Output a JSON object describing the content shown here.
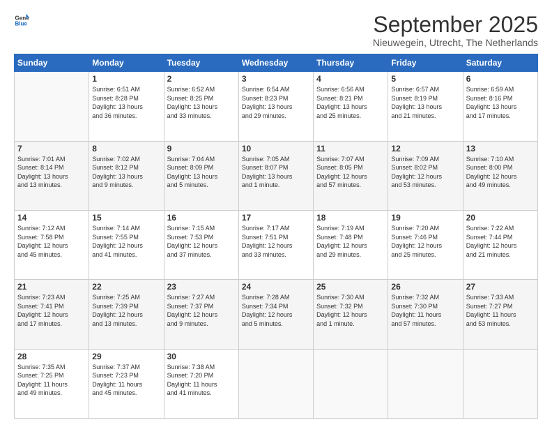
{
  "header": {
    "logo_general": "General",
    "logo_blue": "Blue",
    "month_title": "September 2025",
    "subtitle": "Nieuwegein, Utrecht, The Netherlands"
  },
  "weekdays": [
    "Sunday",
    "Monday",
    "Tuesday",
    "Wednesday",
    "Thursday",
    "Friday",
    "Saturday"
  ],
  "weeks": [
    [
      {
        "day": "",
        "info": ""
      },
      {
        "day": "1",
        "info": "Sunrise: 6:51 AM\nSunset: 8:28 PM\nDaylight: 13 hours\nand 36 minutes."
      },
      {
        "day": "2",
        "info": "Sunrise: 6:52 AM\nSunset: 8:25 PM\nDaylight: 13 hours\nand 33 minutes."
      },
      {
        "day": "3",
        "info": "Sunrise: 6:54 AM\nSunset: 8:23 PM\nDaylight: 13 hours\nand 29 minutes."
      },
      {
        "day": "4",
        "info": "Sunrise: 6:56 AM\nSunset: 8:21 PM\nDaylight: 13 hours\nand 25 minutes."
      },
      {
        "day": "5",
        "info": "Sunrise: 6:57 AM\nSunset: 8:19 PM\nDaylight: 13 hours\nand 21 minutes."
      },
      {
        "day": "6",
        "info": "Sunrise: 6:59 AM\nSunset: 8:16 PM\nDaylight: 13 hours\nand 17 minutes."
      }
    ],
    [
      {
        "day": "7",
        "info": "Sunrise: 7:01 AM\nSunset: 8:14 PM\nDaylight: 13 hours\nand 13 minutes."
      },
      {
        "day": "8",
        "info": "Sunrise: 7:02 AM\nSunset: 8:12 PM\nDaylight: 13 hours\nand 9 minutes."
      },
      {
        "day": "9",
        "info": "Sunrise: 7:04 AM\nSunset: 8:09 PM\nDaylight: 13 hours\nand 5 minutes."
      },
      {
        "day": "10",
        "info": "Sunrise: 7:05 AM\nSunset: 8:07 PM\nDaylight: 13 hours\nand 1 minute."
      },
      {
        "day": "11",
        "info": "Sunrise: 7:07 AM\nSunset: 8:05 PM\nDaylight: 12 hours\nand 57 minutes."
      },
      {
        "day": "12",
        "info": "Sunrise: 7:09 AM\nSunset: 8:02 PM\nDaylight: 12 hours\nand 53 minutes."
      },
      {
        "day": "13",
        "info": "Sunrise: 7:10 AM\nSunset: 8:00 PM\nDaylight: 12 hours\nand 49 minutes."
      }
    ],
    [
      {
        "day": "14",
        "info": "Sunrise: 7:12 AM\nSunset: 7:58 PM\nDaylight: 12 hours\nand 45 minutes."
      },
      {
        "day": "15",
        "info": "Sunrise: 7:14 AM\nSunset: 7:55 PM\nDaylight: 12 hours\nand 41 minutes."
      },
      {
        "day": "16",
        "info": "Sunrise: 7:15 AM\nSunset: 7:53 PM\nDaylight: 12 hours\nand 37 minutes."
      },
      {
        "day": "17",
        "info": "Sunrise: 7:17 AM\nSunset: 7:51 PM\nDaylight: 12 hours\nand 33 minutes."
      },
      {
        "day": "18",
        "info": "Sunrise: 7:19 AM\nSunset: 7:48 PM\nDaylight: 12 hours\nand 29 minutes."
      },
      {
        "day": "19",
        "info": "Sunrise: 7:20 AM\nSunset: 7:46 PM\nDaylight: 12 hours\nand 25 minutes."
      },
      {
        "day": "20",
        "info": "Sunrise: 7:22 AM\nSunset: 7:44 PM\nDaylight: 12 hours\nand 21 minutes."
      }
    ],
    [
      {
        "day": "21",
        "info": "Sunrise: 7:23 AM\nSunset: 7:41 PM\nDaylight: 12 hours\nand 17 minutes."
      },
      {
        "day": "22",
        "info": "Sunrise: 7:25 AM\nSunset: 7:39 PM\nDaylight: 12 hours\nand 13 minutes."
      },
      {
        "day": "23",
        "info": "Sunrise: 7:27 AM\nSunset: 7:37 PM\nDaylight: 12 hours\nand 9 minutes."
      },
      {
        "day": "24",
        "info": "Sunrise: 7:28 AM\nSunset: 7:34 PM\nDaylight: 12 hours\nand 5 minutes."
      },
      {
        "day": "25",
        "info": "Sunrise: 7:30 AM\nSunset: 7:32 PM\nDaylight: 12 hours\nand 1 minute."
      },
      {
        "day": "26",
        "info": "Sunrise: 7:32 AM\nSunset: 7:30 PM\nDaylight: 11 hours\nand 57 minutes."
      },
      {
        "day": "27",
        "info": "Sunrise: 7:33 AM\nSunset: 7:27 PM\nDaylight: 11 hours\nand 53 minutes."
      }
    ],
    [
      {
        "day": "28",
        "info": "Sunrise: 7:35 AM\nSunset: 7:25 PM\nDaylight: 11 hours\nand 49 minutes."
      },
      {
        "day": "29",
        "info": "Sunrise: 7:37 AM\nSunset: 7:23 PM\nDaylight: 11 hours\nand 45 minutes."
      },
      {
        "day": "30",
        "info": "Sunrise: 7:38 AM\nSunset: 7:20 PM\nDaylight: 11 hours\nand 41 minutes."
      },
      {
        "day": "",
        "info": ""
      },
      {
        "day": "",
        "info": ""
      },
      {
        "day": "",
        "info": ""
      },
      {
        "day": "",
        "info": ""
      }
    ]
  ]
}
